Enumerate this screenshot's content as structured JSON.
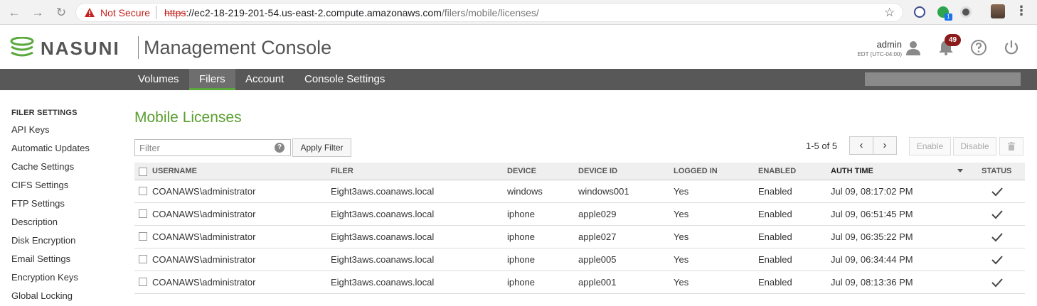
{
  "browser": {
    "security_label": "Not Secure",
    "url_scheme": "https",
    "url_host": "://ec2-18-219-201-54.us-east-2.compute.amazonaws.com",
    "url_path": "/filers/mobile/licenses/",
    "extension_badge": "1"
  },
  "header": {
    "brand": "NASUNI",
    "title": "Management Console",
    "user": "admin",
    "timezone": "EDT (UTC-04:00)",
    "notification_count": "49"
  },
  "nav": {
    "tabs": [
      {
        "label": "Volumes"
      },
      {
        "label": "Filers"
      },
      {
        "label": "Account"
      },
      {
        "label": "Console Settings"
      }
    ],
    "active": "Filers"
  },
  "sidebar": {
    "heading": "FILER SETTINGS",
    "items": [
      {
        "label": "API Keys"
      },
      {
        "label": "Automatic Updates"
      },
      {
        "label": "Cache Settings"
      },
      {
        "label": "CIFS Settings"
      },
      {
        "label": "FTP Settings"
      },
      {
        "label": "Description"
      },
      {
        "label": "Disk Encryption"
      },
      {
        "label": "Email Settings"
      },
      {
        "label": "Encryption Keys"
      },
      {
        "label": "Global Locking"
      }
    ]
  },
  "main": {
    "title": "Mobile Licenses",
    "filter_placeholder": "Filter",
    "apply_filter": "Apply Filter",
    "pager": "1-5 of 5",
    "enable": "Enable",
    "disable": "Disable"
  },
  "table": {
    "columns": {
      "username": "USERNAME",
      "filer": "FILER",
      "device": "DEVICE",
      "device_id": "DEVICE ID",
      "logged_in": "LOGGED IN",
      "enabled": "ENABLED",
      "auth_time": "AUTH TIME",
      "status": "STATUS"
    },
    "rows": [
      {
        "username": "COANAWS\\administrator",
        "filer": "Eight3aws.coanaws.local",
        "device": "windows",
        "device_id": "windows001",
        "logged_in": "Yes",
        "enabled": "Enabled",
        "auth_time": "Jul 09, 08:17:02 PM"
      },
      {
        "username": "COANAWS\\administrator",
        "filer": "Eight3aws.coanaws.local",
        "device": "iphone",
        "device_id": "apple029",
        "logged_in": "Yes",
        "enabled": "Enabled",
        "auth_time": "Jul 09, 06:51:45 PM"
      },
      {
        "username": "COANAWS\\administrator",
        "filer": "Eight3aws.coanaws.local",
        "device": "iphone",
        "device_id": "apple027",
        "logged_in": "Yes",
        "enabled": "Enabled",
        "auth_time": "Jul 09, 06:35:22 PM"
      },
      {
        "username": "COANAWS\\administrator",
        "filer": "Eight3aws.coanaws.local",
        "device": "iphone",
        "device_id": "apple005",
        "logged_in": "Yes",
        "enabled": "Enabled",
        "auth_time": "Jul 09, 06:34:44 PM"
      },
      {
        "username": "COANAWS\\administrator",
        "filer": "Eight3aws.coanaws.local",
        "device": "iphone",
        "device_id": "apple001",
        "logged_in": "Yes",
        "enabled": "Enabled",
        "auth_time": "Jul 09, 08:13:36 PM"
      }
    ]
  },
  "colors": {
    "accent_green": "#5a9e2f",
    "nav_bar": "#585858",
    "notification_badge": "#8b1a1a",
    "insecure_red": "#c5221f"
  },
  "icons": [
    "back-icon",
    "forward-icon",
    "reload-icon",
    "warning-icon",
    "star-icon",
    "user-icon",
    "bell-icon",
    "help-icon",
    "power-icon",
    "chevron-left-icon",
    "chevron-right-icon",
    "trash-icon",
    "check-icon",
    "sort-down-icon"
  ]
}
